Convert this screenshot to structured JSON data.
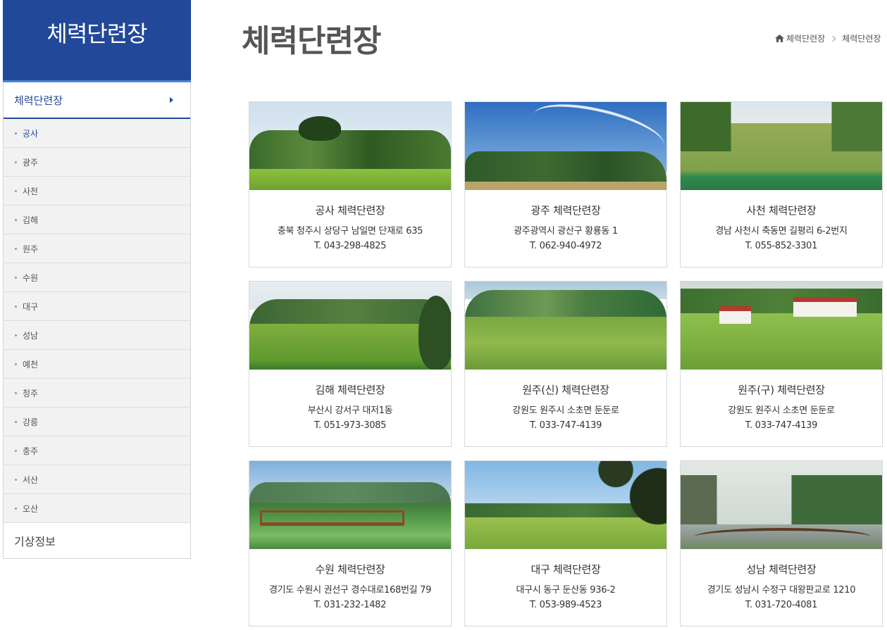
{
  "sidebar": {
    "heading": "체력단련장",
    "category": "체력단련장",
    "items": [
      {
        "label": "공사",
        "active": true
      },
      {
        "label": "광주"
      },
      {
        "label": "사천"
      },
      {
        "label": "김해"
      },
      {
        "label": "원주"
      },
      {
        "label": "수원"
      },
      {
        "label": "대구"
      },
      {
        "label": "성남"
      },
      {
        "label": "예천"
      },
      {
        "label": "청주"
      },
      {
        "label": "강릉"
      },
      {
        "label": "충주"
      },
      {
        "label": "서산"
      },
      {
        "label": "오산"
      }
    ],
    "category2": "기상정보"
  },
  "page": {
    "title": "체력단련장"
  },
  "breadcrumb": {
    "home_icon": "home-icon",
    "item1": "체력단련장",
    "item2": "체력단련장"
  },
  "cards": [
    {
      "title": "공사 체력단련장",
      "address": "충북 청주시 상당구 남일면 단재로 635",
      "phone": "T. 043-298-4825"
    },
    {
      "title": "광주 체력단련장",
      "address": "광주광역시 광산구 황룡동 1",
      "phone": "T. 062-940-4972"
    },
    {
      "title": "사천 체력단련장",
      "address": "경남 사천시 축동면 길평리 6-2번지",
      "phone": "T. 055-852-3301"
    },
    {
      "title": "김해 체력단련장",
      "address": "부산시 강서구 대저1동",
      "phone": "T. 051-973-3085"
    },
    {
      "title": "원주(신) 체력단련장",
      "address": "강원도 원주시 소초면 둔둔로",
      "phone": "T. 033-747-4139"
    },
    {
      "title": "원주(구) 체력단련장",
      "address": "강원도 원주시 소초면 둔둔로",
      "phone": "T. 033-747-4139"
    },
    {
      "title": "수원 체력단련장",
      "address": "경기도 수원시 권선구 경수대로168번길 79",
      "phone": "T. 031-232-1482"
    },
    {
      "title": "대구 체력단련장",
      "address": "대구시 동구 둔산동 936-2",
      "phone": "T. 053-989-4523"
    },
    {
      "title": "성남 체력단련장",
      "address": "경기도 성남시 수정구 대왕판교로 1210",
      "phone": "T. 031-720-4081"
    }
  ],
  "colors": {
    "brand": "#22489a",
    "accent": "#4b86d6"
  }
}
